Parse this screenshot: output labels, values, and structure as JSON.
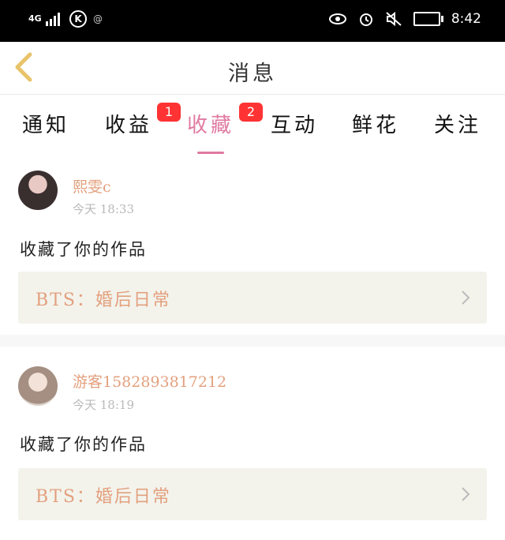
{
  "status_bar": {
    "network": "4G",
    "time": "8:42"
  },
  "header": {
    "title": "消息"
  },
  "tabs": [
    {
      "label": "通知"
    },
    {
      "label": "收益",
      "badge": "1"
    },
    {
      "label": "收藏",
      "badge": "2",
      "active": true
    },
    {
      "label": "互动"
    },
    {
      "label": "鲜花"
    },
    {
      "label": "关注"
    }
  ],
  "messages": [
    {
      "username": "熙雯c",
      "time": "今天 18:33",
      "action": "收藏了你的作品",
      "work_title": "BTS：婚后日常"
    },
    {
      "username": "游客1582893817212",
      "time": "今天 18:19",
      "action": "收藏了你的作品",
      "work_title": "BTS：婚后日常"
    }
  ],
  "colors": {
    "accent_pink": "#e07aa1",
    "username_orange": "#e3a07e",
    "badge_red": "#ff3333",
    "back_arrow": "#e8c36a"
  }
}
